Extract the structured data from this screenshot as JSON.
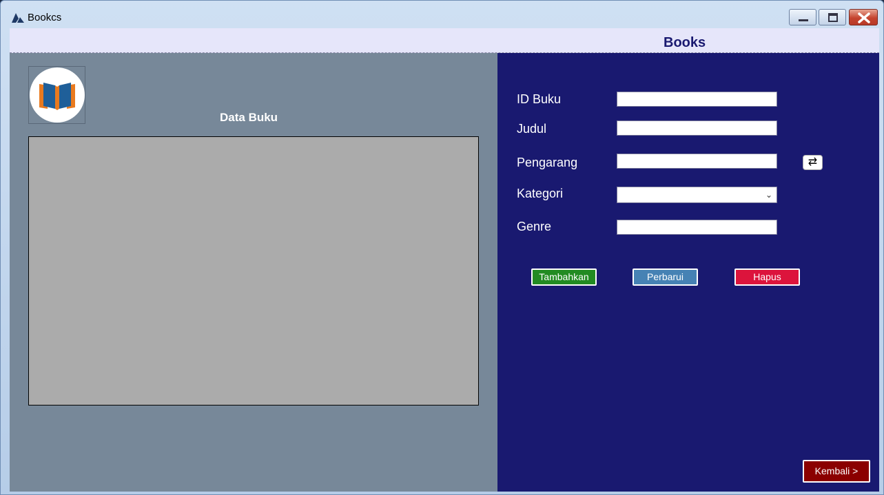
{
  "window": {
    "title": "Bookcs",
    "header_title": "Books"
  },
  "left_panel": {
    "section_title": "Data Buku"
  },
  "form": {
    "fields": {
      "id_buku": {
        "label": "ID Buku",
        "value": ""
      },
      "judul": {
        "label": "Judul",
        "value": ""
      },
      "pengarang": {
        "label": "Pengarang",
        "value": ""
      },
      "kategori": {
        "label": "Kategori",
        "selected": ""
      },
      "genre": {
        "label": "Genre",
        "value": ""
      }
    },
    "swap_icon": "swap-arrows-icon"
  },
  "buttons": {
    "add": "Tambahkan",
    "update": "Perbarui",
    "delete": "Hapus",
    "back": "Kembali >"
  },
  "colors": {
    "header_bg": "#e6e6fa",
    "header_text": "#191970",
    "left_bg": "#778899",
    "right_bg": "#191970",
    "grid_bg": "#ababab",
    "add_btn": "#228b22",
    "update_btn": "#4682b4",
    "delete_btn": "#dc143c",
    "back_btn": "#8b0000"
  }
}
